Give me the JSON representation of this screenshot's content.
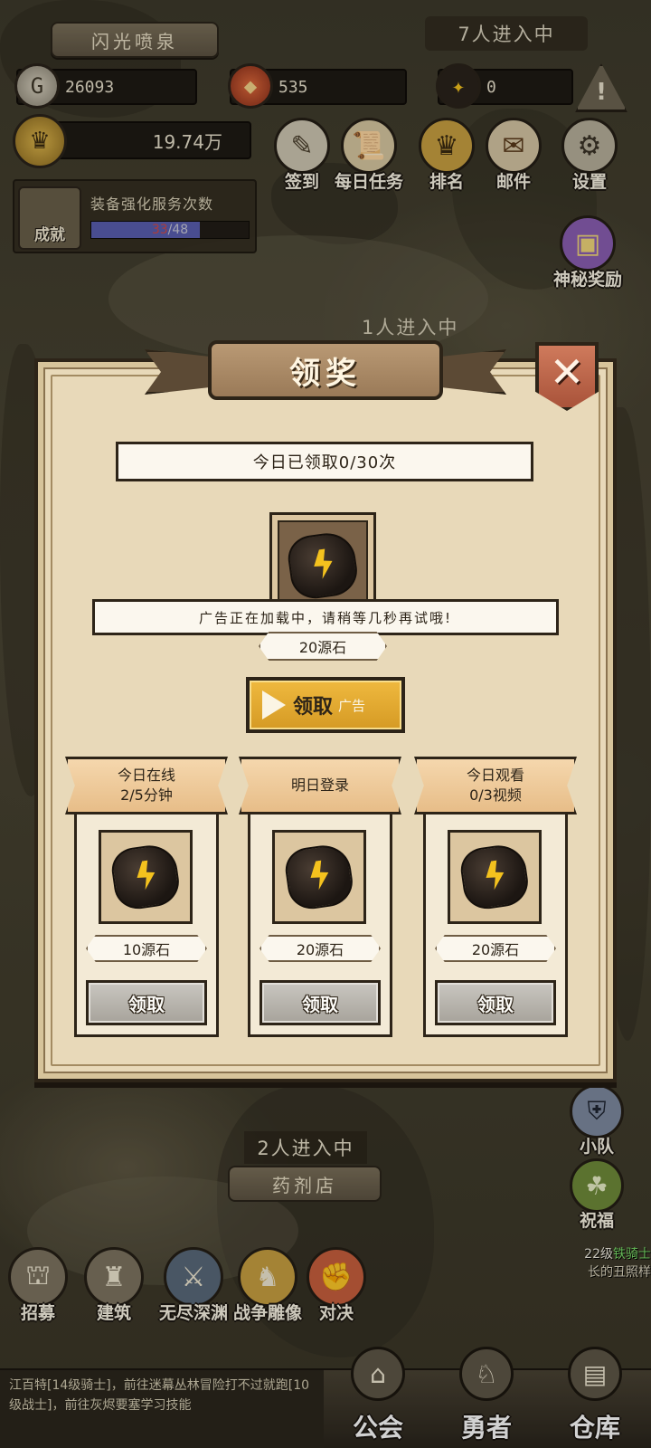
{
  "hud": {
    "location_name": "闪光喷泉",
    "players_top": "7人进入中",
    "gold": "26093",
    "medals": "535",
    "stones": "0",
    "power": "19.74万",
    "enhance": {
      "title": "装备强化服务次数",
      "current": "33",
      "max": "/48",
      "progress_ratio": 0.6875
    },
    "achievement_label": "成就",
    "menu": {
      "checkin": "签到",
      "daily_tasks": "每日任务",
      "ranking": "排名",
      "mail": "邮件",
      "settings": "设置",
      "mystery_reward": "神秘奖励"
    },
    "warn_icon": "!",
    "players_mid": "1人进入中"
  },
  "modal": {
    "title": "领奖",
    "close_icon": "✕",
    "claimed_today": "今日已领取0/30次",
    "toast": "广告正在加载中，请稍等几秒再试哦!",
    "main_reward_amount": "20源石",
    "claim_label": "领取",
    "ad_tag": "广告",
    "cards": [
      {
        "line1": "今日在线",
        "line2": "2/5分钟",
        "amount": "10源石",
        "button": "领取"
      },
      {
        "line1": "明日登录",
        "line2": "",
        "amount": "20源石",
        "button": "领取"
      },
      {
        "line1": "今日观看",
        "line2": "0/3视频",
        "amount": "20源石",
        "button": "领取"
      }
    ]
  },
  "bottom": {
    "players_bot": "2人进入中",
    "shop_name": "药剂店",
    "buttons": {
      "recruit": "招募",
      "build": "建筑",
      "abyss": "无尽深渊",
      "statue": "战争雕像",
      "duel": "对决"
    },
    "side": {
      "team": "小队",
      "blessing": "祝福"
    },
    "npc": {
      "level": "22级",
      "name": "铁骑士",
      "extra": "长的丑照样"
    },
    "quest_text": "江百特[14级骑士]，前往迷幕丛林冒险打不过就跑[10级战士]，前往灰烬要塞学习技能",
    "tabs": {
      "guild": "公会",
      "hero": "勇者",
      "warehouse": "仓库"
    }
  },
  "colors": {
    "gold_button": "#efb93f",
    "modal_bg": "#e8d9b9",
    "close_red": "#cf7a5c",
    "enhance_fill": "#5a5fb0",
    "enhance_current": "#d04a4a"
  }
}
